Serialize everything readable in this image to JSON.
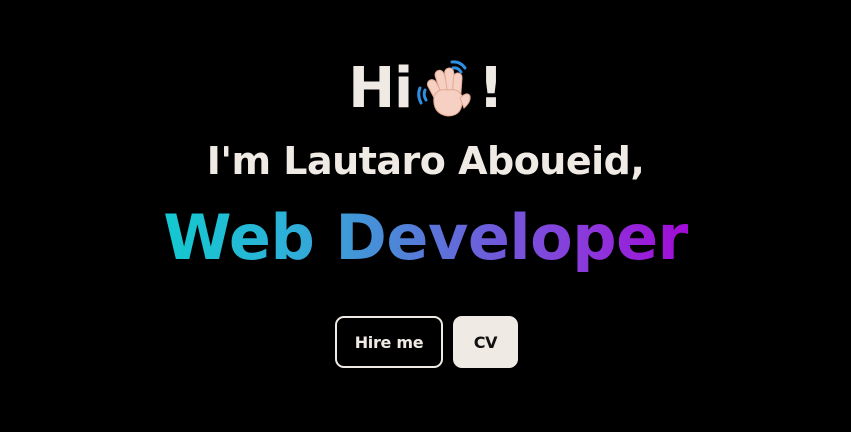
{
  "hero": {
    "greeting_prefix": "Hi",
    "greeting_suffix": "!",
    "wave_icon": "waving-hand-icon",
    "intro": "I'm Lautaro Aboueid,",
    "role": "Web Developer",
    "role_gradient": [
      "#13c9cf",
      "#4a8bd8",
      "#8a3adb",
      "#a20bd8"
    ]
  },
  "actions": {
    "hire_label": "Hire me",
    "cv_label": "CV"
  },
  "colors": {
    "background": "#000000",
    "text": "#efeae4"
  }
}
